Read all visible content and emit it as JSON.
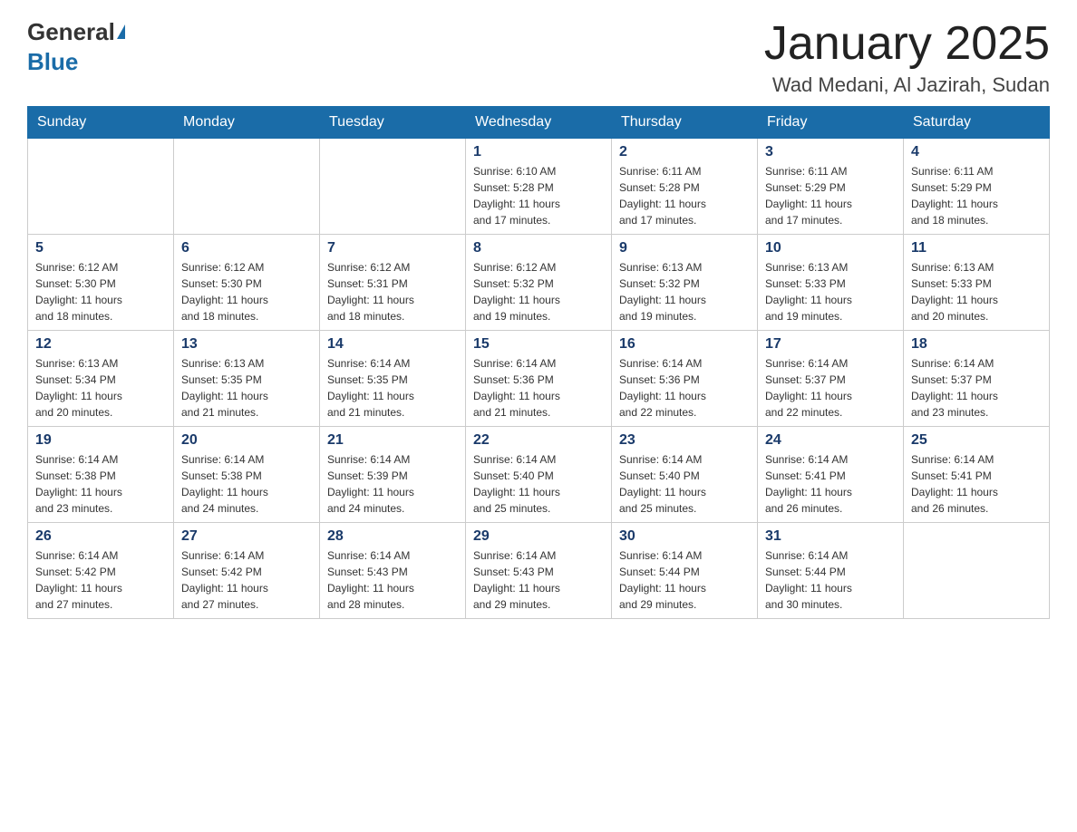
{
  "header": {
    "logo_general": "General",
    "logo_blue": "Blue",
    "month_title": "January 2025",
    "location": "Wad Medani, Al Jazirah, Sudan"
  },
  "calendar": {
    "days_of_week": [
      "Sunday",
      "Monday",
      "Tuesday",
      "Wednesday",
      "Thursday",
      "Friday",
      "Saturday"
    ],
    "weeks": [
      [
        {
          "day": "",
          "info": ""
        },
        {
          "day": "",
          "info": ""
        },
        {
          "day": "",
          "info": ""
        },
        {
          "day": "1",
          "info": "Sunrise: 6:10 AM\nSunset: 5:28 PM\nDaylight: 11 hours\nand 17 minutes."
        },
        {
          "day": "2",
          "info": "Sunrise: 6:11 AM\nSunset: 5:28 PM\nDaylight: 11 hours\nand 17 minutes."
        },
        {
          "day": "3",
          "info": "Sunrise: 6:11 AM\nSunset: 5:29 PM\nDaylight: 11 hours\nand 17 minutes."
        },
        {
          "day": "4",
          "info": "Sunrise: 6:11 AM\nSunset: 5:29 PM\nDaylight: 11 hours\nand 18 minutes."
        }
      ],
      [
        {
          "day": "5",
          "info": "Sunrise: 6:12 AM\nSunset: 5:30 PM\nDaylight: 11 hours\nand 18 minutes."
        },
        {
          "day": "6",
          "info": "Sunrise: 6:12 AM\nSunset: 5:30 PM\nDaylight: 11 hours\nand 18 minutes."
        },
        {
          "day": "7",
          "info": "Sunrise: 6:12 AM\nSunset: 5:31 PM\nDaylight: 11 hours\nand 18 minutes."
        },
        {
          "day": "8",
          "info": "Sunrise: 6:12 AM\nSunset: 5:32 PM\nDaylight: 11 hours\nand 19 minutes."
        },
        {
          "day": "9",
          "info": "Sunrise: 6:13 AM\nSunset: 5:32 PM\nDaylight: 11 hours\nand 19 minutes."
        },
        {
          "day": "10",
          "info": "Sunrise: 6:13 AM\nSunset: 5:33 PM\nDaylight: 11 hours\nand 19 minutes."
        },
        {
          "day": "11",
          "info": "Sunrise: 6:13 AM\nSunset: 5:33 PM\nDaylight: 11 hours\nand 20 minutes."
        }
      ],
      [
        {
          "day": "12",
          "info": "Sunrise: 6:13 AM\nSunset: 5:34 PM\nDaylight: 11 hours\nand 20 minutes."
        },
        {
          "day": "13",
          "info": "Sunrise: 6:13 AM\nSunset: 5:35 PM\nDaylight: 11 hours\nand 21 minutes."
        },
        {
          "day": "14",
          "info": "Sunrise: 6:14 AM\nSunset: 5:35 PM\nDaylight: 11 hours\nand 21 minutes."
        },
        {
          "day": "15",
          "info": "Sunrise: 6:14 AM\nSunset: 5:36 PM\nDaylight: 11 hours\nand 21 minutes."
        },
        {
          "day": "16",
          "info": "Sunrise: 6:14 AM\nSunset: 5:36 PM\nDaylight: 11 hours\nand 22 minutes."
        },
        {
          "day": "17",
          "info": "Sunrise: 6:14 AM\nSunset: 5:37 PM\nDaylight: 11 hours\nand 22 minutes."
        },
        {
          "day": "18",
          "info": "Sunrise: 6:14 AM\nSunset: 5:37 PM\nDaylight: 11 hours\nand 23 minutes."
        }
      ],
      [
        {
          "day": "19",
          "info": "Sunrise: 6:14 AM\nSunset: 5:38 PM\nDaylight: 11 hours\nand 23 minutes."
        },
        {
          "day": "20",
          "info": "Sunrise: 6:14 AM\nSunset: 5:38 PM\nDaylight: 11 hours\nand 24 minutes."
        },
        {
          "day": "21",
          "info": "Sunrise: 6:14 AM\nSunset: 5:39 PM\nDaylight: 11 hours\nand 24 minutes."
        },
        {
          "day": "22",
          "info": "Sunrise: 6:14 AM\nSunset: 5:40 PM\nDaylight: 11 hours\nand 25 minutes."
        },
        {
          "day": "23",
          "info": "Sunrise: 6:14 AM\nSunset: 5:40 PM\nDaylight: 11 hours\nand 25 minutes."
        },
        {
          "day": "24",
          "info": "Sunrise: 6:14 AM\nSunset: 5:41 PM\nDaylight: 11 hours\nand 26 minutes."
        },
        {
          "day": "25",
          "info": "Sunrise: 6:14 AM\nSunset: 5:41 PM\nDaylight: 11 hours\nand 26 minutes."
        }
      ],
      [
        {
          "day": "26",
          "info": "Sunrise: 6:14 AM\nSunset: 5:42 PM\nDaylight: 11 hours\nand 27 minutes."
        },
        {
          "day": "27",
          "info": "Sunrise: 6:14 AM\nSunset: 5:42 PM\nDaylight: 11 hours\nand 27 minutes."
        },
        {
          "day": "28",
          "info": "Sunrise: 6:14 AM\nSunset: 5:43 PM\nDaylight: 11 hours\nand 28 minutes."
        },
        {
          "day": "29",
          "info": "Sunrise: 6:14 AM\nSunset: 5:43 PM\nDaylight: 11 hours\nand 29 minutes."
        },
        {
          "day": "30",
          "info": "Sunrise: 6:14 AM\nSunset: 5:44 PM\nDaylight: 11 hours\nand 29 minutes."
        },
        {
          "day": "31",
          "info": "Sunrise: 6:14 AM\nSunset: 5:44 PM\nDaylight: 11 hours\nand 30 minutes."
        },
        {
          "day": "",
          "info": ""
        }
      ]
    ]
  }
}
